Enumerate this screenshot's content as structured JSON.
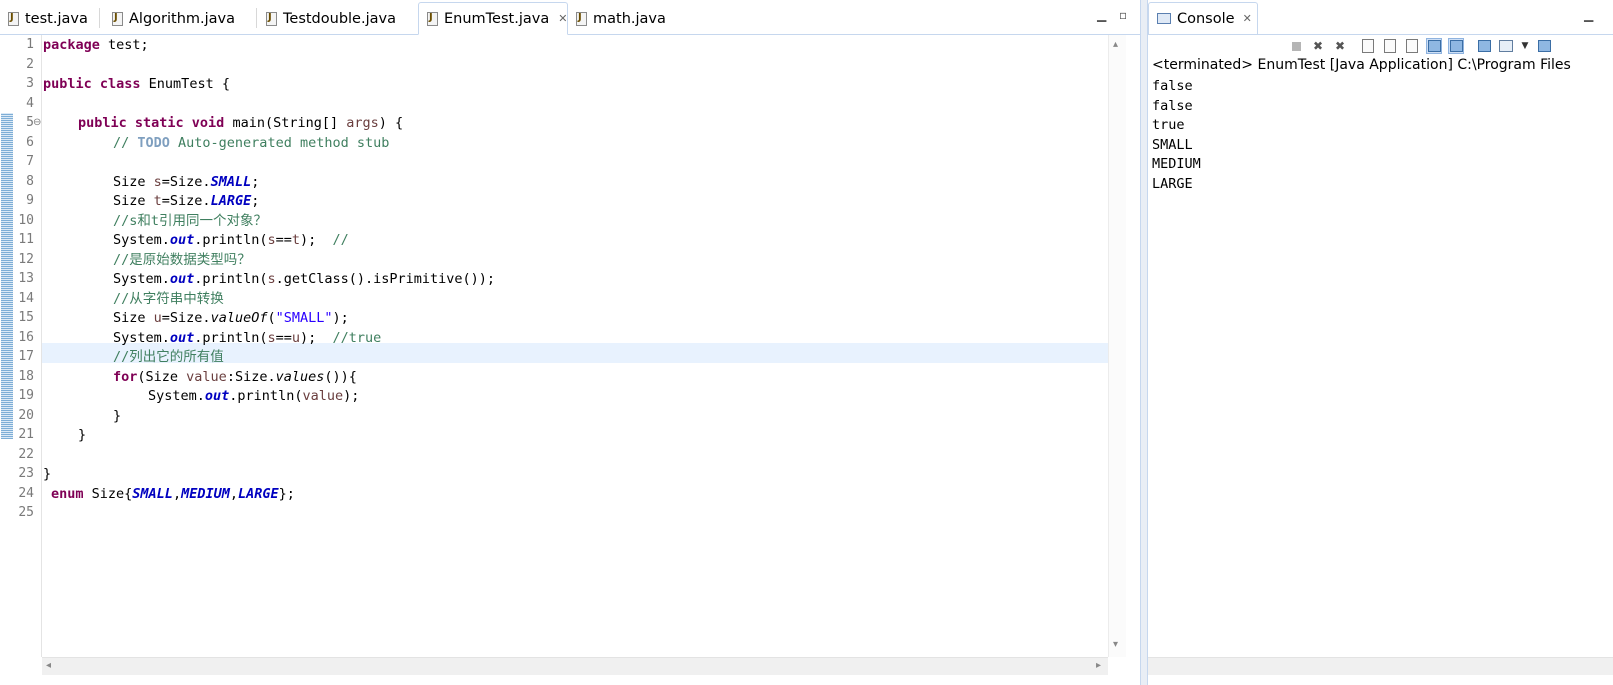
{
  "editor": {
    "tabs": [
      {
        "label": "test.java"
      },
      {
        "label": "Algorithm.java"
      },
      {
        "label": "Testdouble.java"
      },
      {
        "label": "EnumTest.java",
        "active": true
      },
      {
        "label": "math.java"
      }
    ],
    "line_numbers": [
      "1",
      "2",
      "3",
      "4",
      "5",
      "6",
      "7",
      "8",
      "9",
      "10",
      "11",
      "12",
      "13",
      "14",
      "15",
      "16",
      "17",
      "18",
      "19",
      "20",
      "21",
      "22",
      "23",
      "24",
      "25"
    ],
    "current_line": 17,
    "code": {
      "l1_kw": "package",
      "l1_rest": " test;",
      "l3_kw": "public class",
      "l3_rest": " EnumTest {",
      "l5_kw": "public static void",
      "l5_a": " main(String[] ",
      "l5_var": "args",
      "l5_b": ") {",
      "l6_cm": "// ",
      "l6_todo": "TODO",
      "l6_rest": " Auto-generated method stub",
      "l8_a": "Size ",
      "l8_var": "s",
      "l8_b": "=Size.",
      "l8_fld": "SMALL",
      "l8_c": ";",
      "l9_a": "Size ",
      "l9_var": "t",
      "l9_b": "=Size.",
      "l9_fld": "LARGE",
      "l9_c": ";",
      "l10_cm": "//s和t引用同一个对象？",
      "l11_a": "System.",
      "l11_fld": "out",
      "l11_b": ".println(",
      "l11_var1": "s",
      "l11_c": "==",
      "l11_var2": "t",
      "l11_d": ");  ",
      "l11_cm": "//",
      "l12_cm": "//是原始数据类型吗？",
      "l13_a": "System.",
      "l13_fld": "out",
      "l13_b": ".println(",
      "l13_var": "s",
      "l13_c": ".getClass().isPrimitive());",
      "l14_cm": "//从字符串中转换",
      "l15_a": "Size ",
      "l15_var": "u",
      "l15_b": "=Size.",
      "l15_st": "valueOf",
      "l15_c": "(",
      "l15_str": "\"SMALL\"",
      "l15_d": ");",
      "l16_a": "System.",
      "l16_fld": "out",
      "l16_b": ".println(",
      "l16_var1": "s",
      "l16_c": "==",
      "l16_var2": "u",
      "l16_d": ");  ",
      "l16_cm": "//true",
      "l17_cm": "//列出它的所有值",
      "l18_kw": "for",
      "l18_a": "(Size ",
      "l18_var": "value",
      "l18_b": ":Size.",
      "l18_st": "values",
      "l18_c": "()){",
      "l19_a": "System.",
      "l19_fld": "out",
      "l19_b": ".println(",
      "l19_var": "value",
      "l19_c": ");",
      "l20": "}",
      "l21": "}",
      "l23": "}",
      "l24_kw": "enum",
      "l24_a": " Size{",
      "l24_f1": "SMALL",
      "l24_s1": ",",
      "l24_f2": "MEDIUM",
      "l24_s2": ",",
      "l24_f3": "LARGE",
      "l24_b": "};"
    }
  },
  "console": {
    "tab_label": "Console",
    "status": "<terminated> EnumTest [Java Application] C:\\Program Files",
    "output": [
      "false",
      "false",
      "true",
      "SMALL",
      "MEDIUM",
      "LARGE"
    ]
  },
  "colors": {
    "keyword": "#7f0055",
    "comment": "#3f7f5f",
    "field": "#0000c0",
    "string": "#2a00ff",
    "current_line": "#e8f2fe"
  }
}
